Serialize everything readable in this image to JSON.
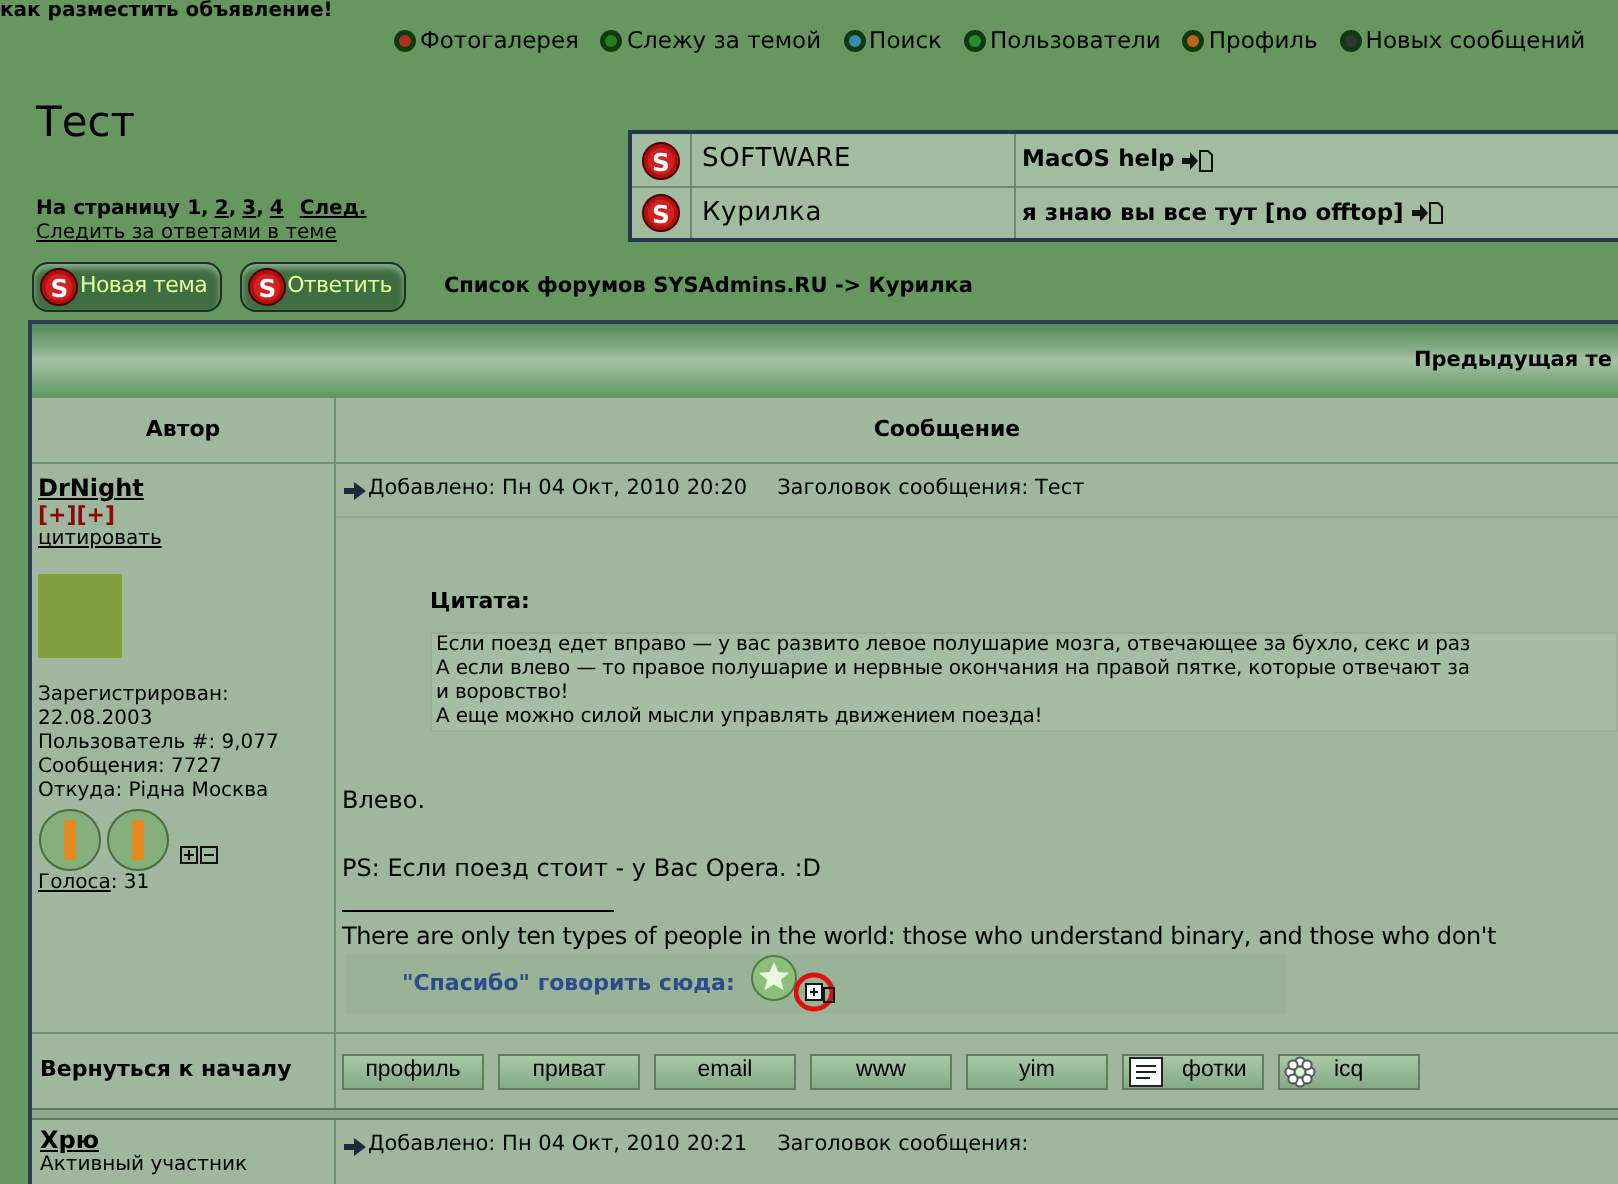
{
  "top_notice": "как разместить объявление!",
  "nav": [
    "Фотогалерея",
    "Слежу за темой",
    "Поиск",
    "Пользователи",
    "Профиль",
    "Новых сообщений"
  ],
  "title": "Тест",
  "topics": [
    {
      "icon_letter": "S",
      "forum": "SOFTWARE",
      "topic": "MacOS help"
    },
    {
      "icon_letter": "S",
      "forum": "Курилка",
      "topic": "я знаю вы все тут [no offtop]"
    }
  ],
  "pagination": {
    "label": "На страницу",
    "current": "1",
    "pages": [
      {
        "separator": ",",
        "label": "2"
      },
      {
        "separator": ",",
        "label": "3"
      },
      {
        "separator": ",",
        "label": "4"
      }
    ],
    "next": "След."
  },
  "watch_link": "Следить за ответами в теме",
  "buttons": [
    {
      "icon_letter": "S",
      "label": "Новая тема"
    },
    {
      "icon_letter": "S",
      "label": "Ответить"
    }
  ],
  "breadcrumb": "Список форумов SYSAdmins.RU -> Курилка",
  "table": {
    "banner": "Предыдущая те",
    "columns": [
      "Автор",
      "Сообщение"
    ]
  },
  "posts": [
    {
      "author": "DrNight",
      "rating": "[+][+]",
      "quote_link": "цитировать",
      "details": [
        "Зарегистрирован:",
        "22.08.2003",
        "Пользователь #: 9,077",
        "Сообщения: 7727",
        "Откуда: Рідна Москва"
      ],
      "votes_label": "Голоса",
      "votes_value": ": 31",
      "posted": "Добавлено: Пн 04 Окт, 2010 20:20",
      "subject": "Заголовок сообщения: Тест",
      "quote_title": "Цитата:",
      "quote_lines": [
        "Если поезд едет вправо — у вас развито левое полушарие мозга, отвечающее за бухло, секс и раз",
        "А если влево — то правое полушарие и нервные окончания на правой пятке, которые отвечают за",
        "и воровство!",
        "А еще можно силой мысли управлять движением поезда!"
      ],
      "body": [
        "Влево.",
        "PS: Если поезд стоит - у Вас Opera. :D"
      ],
      "signature": "There are only ten types of people in the world: those who understand binary, and those who don't",
      "thanks": "\"Спасибо\" говорить сюда:"
    },
    {
      "author": "Хрю",
      "rank": "Активный участник",
      "posted": "Добавлено: Пн 04 Окт, 2010 20:21",
      "subject": "Заголовок сообщения:"
    }
  ],
  "back_to_top": "Вернуться к началу",
  "profile_buttons": [
    {
      "label": "профиль",
      "kind": "text"
    },
    {
      "label": "приват",
      "kind": "text"
    },
    {
      "label": "email",
      "kind": "text"
    },
    {
      "label": "www",
      "kind": "text"
    },
    {
      "label": "yim",
      "kind": "text"
    },
    {
      "label": "фотки",
      "kind": "photo"
    },
    {
      "label": "icq",
      "kind": "icq"
    }
  ]
}
